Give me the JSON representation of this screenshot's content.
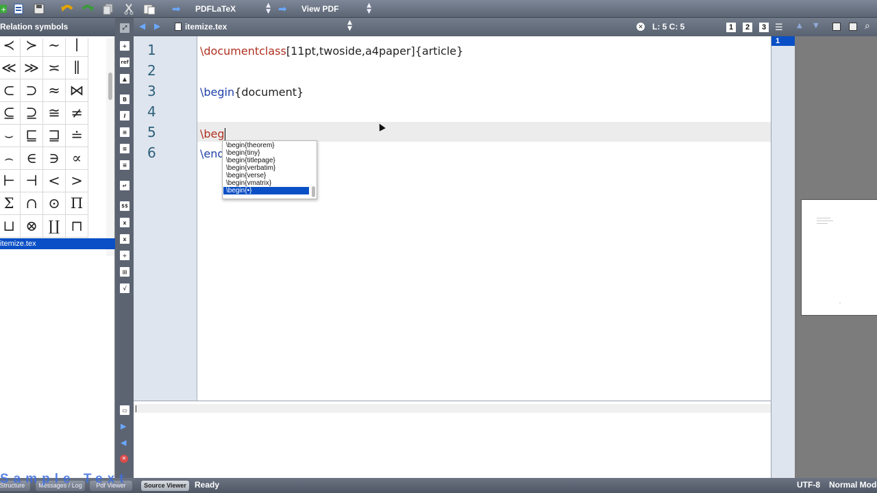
{
  "toolbar": {
    "compiler_select": "PDFLaTeX",
    "viewer_select": "View PDF",
    "icons": [
      "new-file-icon",
      "open-file-icon",
      "save-icon",
      "undo-icon",
      "redo-icon",
      "copy-icon",
      "cut-icon",
      "paste-icon"
    ]
  },
  "left_panel": {
    "header": "Relation symbols",
    "symbols": [
      "≺",
      "≻",
      "∼",
      "∣",
      "≪",
      "≫",
      "≍",
      "∥",
      "⊂",
      "⊃",
      "≈",
      "⋈",
      "⊆",
      "⊇",
      "≅",
      "≠",
      "⌣",
      "⊑",
      "⊒",
      "≐",
      "⌢",
      "∈",
      "∋",
      "∝",
      "⊢",
      "⊣",
      "<",
      ">",
      "Σ",
      "∩",
      "⊙",
      "Π",
      "⊔",
      "⊗",
      "∐",
      "⊓"
    ],
    "structure_item": "itemize.tex"
  },
  "editor_tabs": {
    "filename": "itemize.tex",
    "position": "L: 5 C: 5",
    "view_buttons": [
      "1",
      "2",
      "3"
    ]
  },
  "editor": {
    "line_numbers": [
      "1",
      "2",
      "3",
      "4",
      "5",
      "6"
    ],
    "line1": {
      "cmd": "\\documentclass",
      "rest": "[11pt,twoside,a4paper]{article}"
    },
    "line3": {
      "cmd": "\\begin",
      "rest": "{document}"
    },
    "line5": {
      "cmd": "\\beg"
    },
    "line6": {
      "cmd": "\\end"
    }
  },
  "completer": {
    "items": [
      "\\begin{theorem}",
      "\\begin{tiny}",
      "\\begin{titlepage}",
      "\\begin{verbatim}",
      "\\begin{verse}",
      "\\begin{vmatrix}",
      "\\begin{•}"
    ],
    "selected_index": 6
  },
  "pdf": {
    "page_number": "1"
  },
  "statusbar": {
    "buttons": [
      "Structure",
      "Messages / Log",
      "Pdf Viewer",
      "Source Viewer"
    ],
    "status": "Ready",
    "encoding": "UTF-8",
    "mode": "Normal Mode",
    "watermark": "Sample Text"
  },
  "colors": {
    "selection": "#0a4fc5",
    "keyword_red": "#b03020",
    "keyword_blue": "#1f3fa8",
    "gutter": "#dfe5ee"
  }
}
